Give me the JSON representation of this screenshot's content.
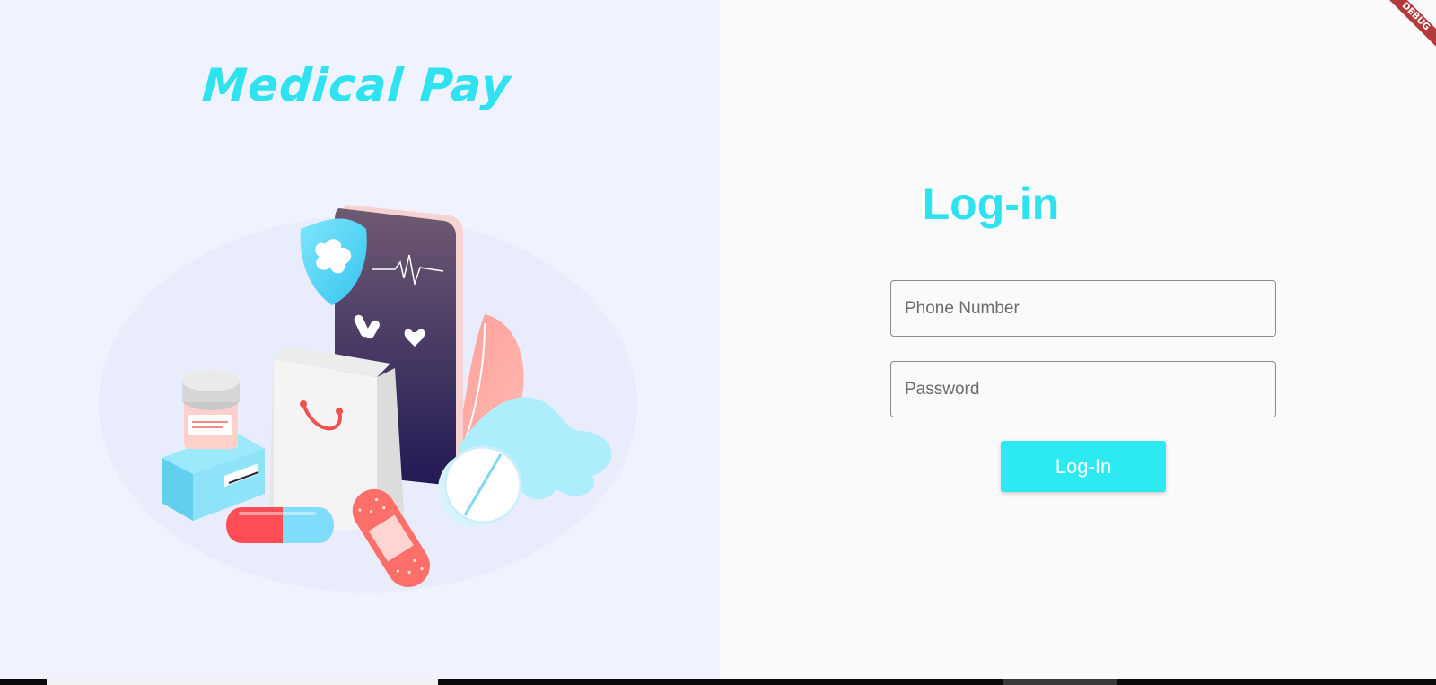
{
  "brand": {
    "title": "Medical Pay"
  },
  "login": {
    "heading": "Log-in",
    "phone_placeholder": "Phone Number",
    "password_placeholder": "Password",
    "submit_label": "Log-In"
  },
  "debug_banner": {
    "label": "DEBUG"
  },
  "colors": {
    "accent": "#2fe2ef",
    "left_background": "#f0f3ff",
    "right_background": "#fafafa",
    "button": "#2de9f1"
  }
}
